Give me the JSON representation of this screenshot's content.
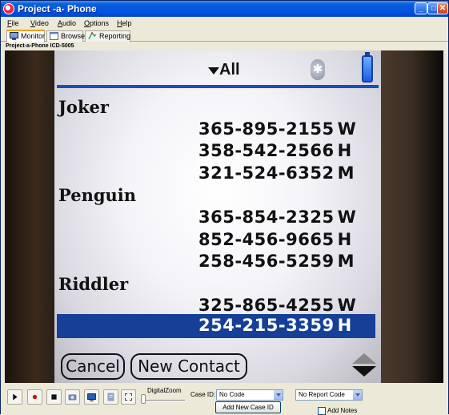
{
  "window": {
    "title": "Project -a- Phone"
  },
  "menu": [
    "File",
    "Video",
    "Audio",
    "Options",
    "Help"
  ],
  "tabs": [
    {
      "label": "Monitor",
      "active": true
    },
    {
      "label": "Browser",
      "active": false
    },
    {
      "label": "Reporting",
      "active": false
    }
  ],
  "device_label": "Project-a-Phone ICD-5005",
  "phone_screen": {
    "filter": "All",
    "contacts": [
      {
        "name": "Joker",
        "numbers": [
          {
            "number": "365-895-2155",
            "type": "W"
          },
          {
            "number": "358-542-2566",
            "type": "H"
          },
          {
            "number": "321-524-6352",
            "type": "M"
          }
        ]
      },
      {
        "name": "Penguin",
        "numbers": [
          {
            "number": "365-854-2325",
            "type": "W"
          },
          {
            "number": "852-456-9665",
            "type": "H"
          },
          {
            "number": "258-456-5259",
            "type": "M"
          }
        ]
      },
      {
        "name": "Riddler",
        "numbers": [
          {
            "number": "325-865-4255",
            "type": "W"
          },
          {
            "number": "254-215-3359",
            "type": "H"
          }
        ]
      }
    ],
    "buttons": {
      "cancel": "Cancel",
      "new_contact": "New Contact"
    }
  },
  "controls": {
    "digital_zoom_label": "DigitalZoom",
    "case_id_label": "Case ID:",
    "case_id_value": "No Code",
    "report_code_value": "No Report Code",
    "add_case_button": "Add New Case ID",
    "add_notes_label": "Add Notes"
  },
  "colors": {
    "title_bar": "#0055e5",
    "selection": "#163f98",
    "divider": "#1a4eb8"
  }
}
